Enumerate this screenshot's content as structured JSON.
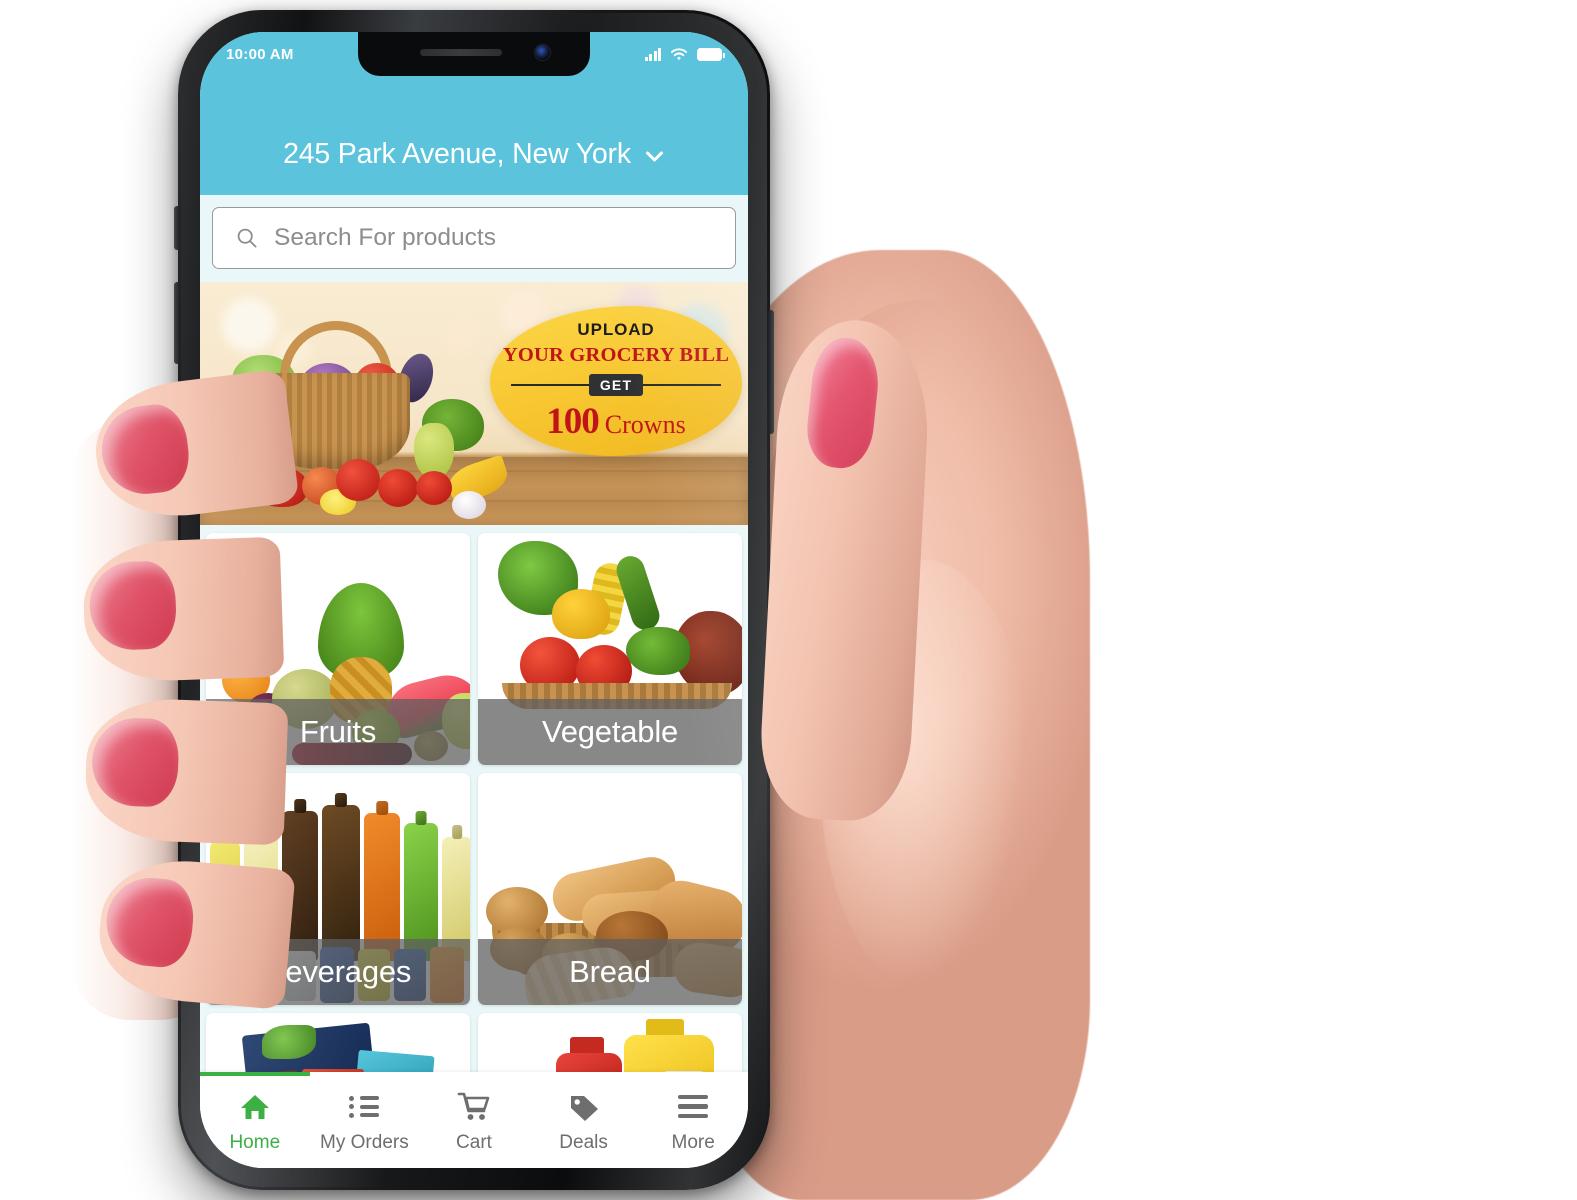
{
  "status_bar": {
    "time": "10:00 AM",
    "icons": [
      "signal-icon",
      "wifi-icon",
      "battery-icon"
    ]
  },
  "header": {
    "address": "245 Park Avenue, New York",
    "dropdown_icon": "chevron-down-icon"
  },
  "search": {
    "placeholder": "Search For products",
    "value": "",
    "icon": "search-icon"
  },
  "banner": {
    "upload_label": "UPLOAD",
    "bill_label": "YOUR GROCERY BILL",
    "get_label": "GET",
    "amount": "100",
    "currency_label": "Crowns"
  },
  "categories": [
    {
      "label": "Fruits",
      "name": "category-tile-fruits"
    },
    {
      "label": "Vegetable",
      "name": "category-tile-vegetable"
    },
    {
      "label": "Beverages",
      "name": "category-tile-beverages"
    },
    {
      "label": "Bread",
      "name": "category-tile-bread"
    },
    {
      "label": "",
      "name": "category-tile-snacks"
    },
    {
      "label": "",
      "name": "category-tile-oil"
    }
  ],
  "bottom_nav": {
    "items": [
      {
        "label": "Home",
        "icon": "home-icon",
        "active": true
      },
      {
        "label": "My Orders",
        "icon": "list-icon",
        "active": false
      },
      {
        "label": "Cart",
        "icon": "cart-icon",
        "active": false
      },
      {
        "label": "Deals",
        "icon": "tag-icon",
        "active": false
      },
      {
        "label": "More",
        "icon": "menu-icon",
        "active": false
      }
    ]
  },
  "colors": {
    "header_teal": "#5BC4DC",
    "page_bg": "#EAF7F8",
    "active_green": "#3CB043",
    "badge_yellow": "#F7C52F",
    "badge_red": "#C01418",
    "label_overlay": "rgba(95,95,95,0.74)"
  }
}
